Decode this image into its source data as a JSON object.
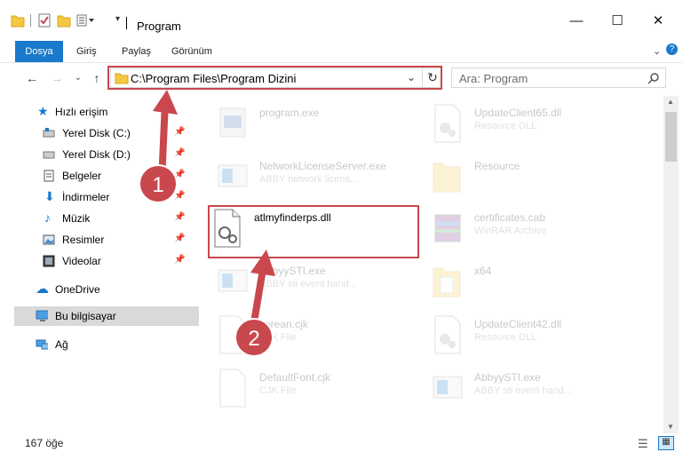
{
  "window": {
    "title": "Program"
  },
  "ribbon": {
    "tabs": [
      "Dosya",
      "Giriş",
      "Paylaş",
      "Görünüm"
    ]
  },
  "address": {
    "path": "C:\\Program Files\\Program Dizini"
  },
  "search": {
    "placeholder": "Ara: Program"
  },
  "sidebar": {
    "quick_access": "Hızlı erişim",
    "items": [
      {
        "label": "Yerel Disk (C:)"
      },
      {
        "label": "Yerel Disk (D:)"
      },
      {
        "label": "Belgeler"
      },
      {
        "label": "İndirmeler"
      },
      {
        "label": "Müzik"
      },
      {
        "label": "Resimler"
      },
      {
        "label": "Videolar"
      }
    ],
    "onedrive": "OneDrive",
    "this_pc": "Bu bilgisayar",
    "network": "Ağ"
  },
  "files": [
    {
      "name": "program.exe",
      "desc": ""
    },
    {
      "name": "UpdateClient65.dll",
      "desc": "Resource DLL"
    },
    {
      "name": "NetworkLicenseServer.exe",
      "desc": "ABBY network licens..."
    },
    {
      "name": "Resource",
      "desc": ""
    },
    {
      "name": "atlmyfinderps.dll",
      "desc": ""
    },
    {
      "name": "certificates.cab",
      "desc": "WinRAR Archive"
    },
    {
      "name": "AbbyySTI.exe",
      "desc": "ABBY sti event hand..."
    },
    {
      "name": "x64",
      "desc": ""
    },
    {
      "name": "korean.cjk",
      "desc": "CJK File"
    },
    {
      "name": "UpdateClient42.dll",
      "desc": "Resource DLL"
    },
    {
      "name": "DefaultFont.cjk",
      "desc": "CJK File"
    },
    {
      "name": "AbbyySTI.exe",
      "desc": "ABBY sti event hand..."
    }
  ],
  "status": {
    "count": "167 öğe"
  },
  "callouts": {
    "one": "1",
    "two": "2"
  },
  "colors": {
    "accent": "#1979ca",
    "highlight": "#c8484e",
    "folder": "#f5c842"
  }
}
